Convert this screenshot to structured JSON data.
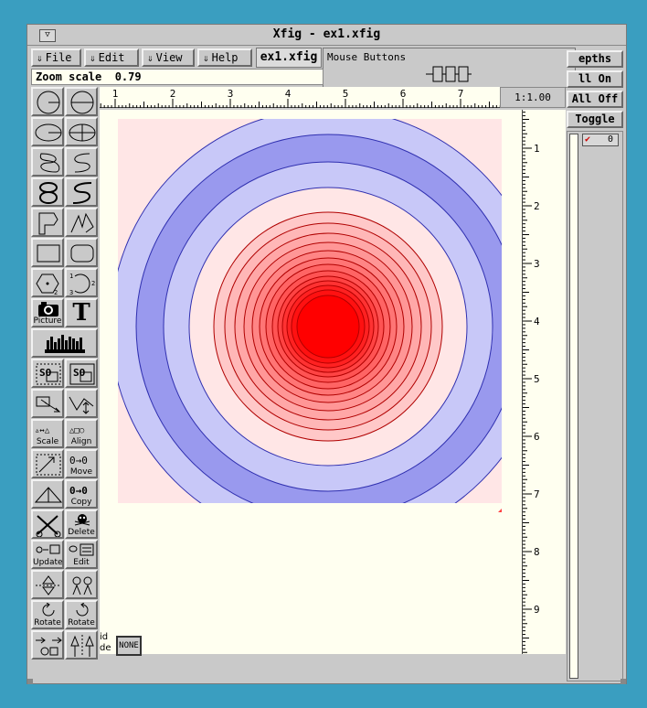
{
  "window": {
    "title": "Xfig - ex1.xfig"
  },
  "menu": [
    {
      "label": "File"
    },
    {
      "label": "Edit"
    },
    {
      "label": "View"
    },
    {
      "label": "Help"
    }
  ],
  "filename": "ex1.xfig",
  "mouse_buttons": {
    "label": "Mouse Buttons"
  },
  "zoom": {
    "label": "Zoom scale",
    "value": "0.79"
  },
  "ruler": {
    "top_ticks": [
      "1",
      "2",
      "3",
      "4",
      "5",
      "6",
      "7"
    ],
    "right_ticks": [
      "1",
      "2",
      "3",
      "4",
      "5",
      "6",
      "7",
      "8",
      "9"
    ],
    "scale": "1:1.00"
  },
  "tools": {
    "picture": "Picture",
    "text": "T",
    "scale": "Scale",
    "align": "Align",
    "move": "Move",
    "copy": "Copy",
    "delete": "Delete",
    "update": "Update",
    "edit": "Edit",
    "rotate_ccw": "Rotate",
    "rotate_cw": "Rotate"
  },
  "bottom": {
    "grid_mode": "id\nde",
    "none": "NONE"
  },
  "depths": {
    "header": "epths",
    "all_on": "ll On",
    "all_off": "All Off",
    "toggle": "Toggle",
    "items": [
      {
        "checked": true,
        "label": "0"
      }
    ]
  },
  "colors": {
    "desktop": "#3a9ec0",
    "panel": "#c9c9c9",
    "canvas": "#fffff0",
    "contour_red_center": "#ff0000",
    "contour_blue_dark": "#9999ee",
    "contour_blue_light": "#c8c8f8",
    "contour_pink": "#ffe6e6"
  }
}
